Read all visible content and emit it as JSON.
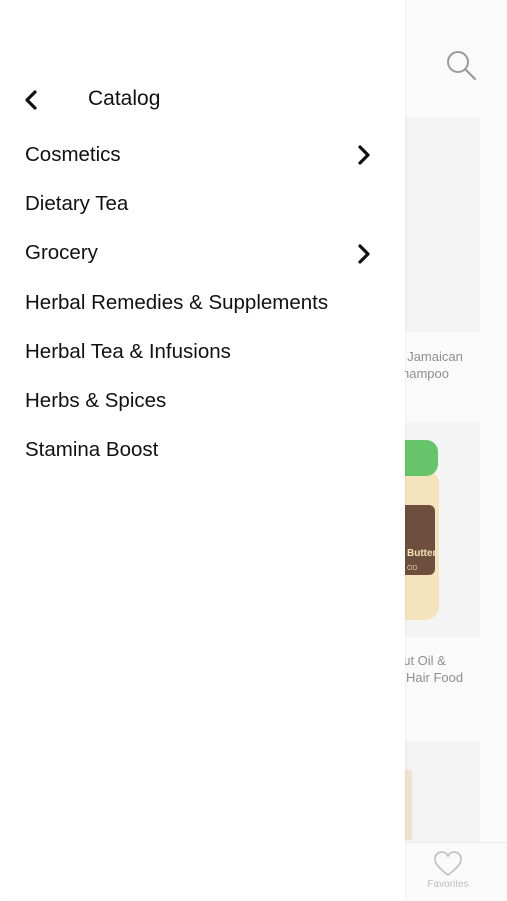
{
  "drawer": {
    "title": "Catalog",
    "categories": [
      {
        "label": "Cosmetics",
        "has_children": true
      },
      {
        "label": "Dietary Tea",
        "has_children": false
      },
      {
        "label": "Grocery",
        "has_children": true
      },
      {
        "label": "Herbal Remedies & Supplements",
        "has_children": false
      },
      {
        "label": "Herbal Tea & Infusions",
        "has_children": false
      },
      {
        "label": "Herbs & Spices",
        "has_children": false
      },
      {
        "label": "Stamina Boost",
        "has_children": false
      }
    ]
  },
  "background": {
    "products": [
      {
        "title_line1": "< Jamaican",
        "title_line2": "hampoo"
      },
      {
        "title_line1": "nut Oil &",
        "title_line2": "Hair Food"
      }
    ],
    "jar_label": "Butter",
    "jar_sub": "OD",
    "tabbar": {
      "favorites_label": "Favorites"
    }
  },
  "colors": {
    "drawer_bg": "#ffffff",
    "text": "#111111",
    "muted": "#8f8f8f",
    "accent_green": "#66c46a"
  }
}
